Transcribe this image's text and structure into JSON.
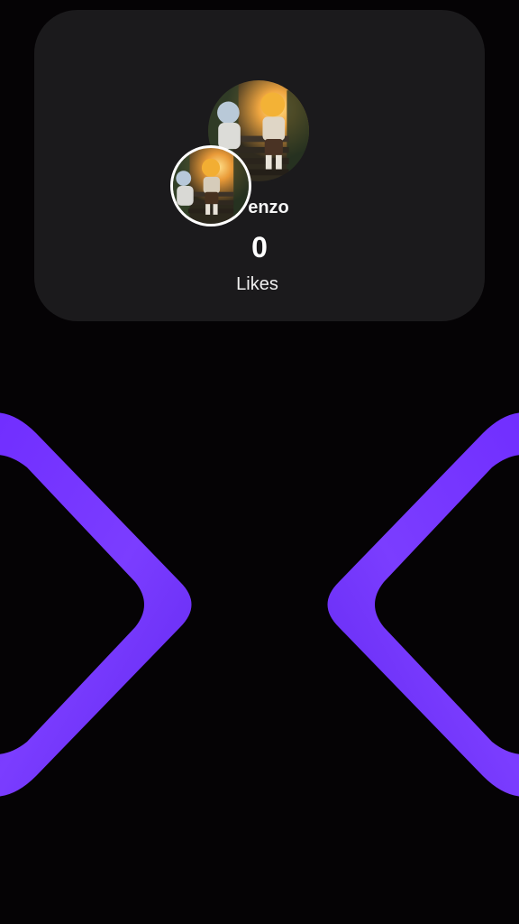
{
  "profile": {
    "username": "enzo",
    "likes_count": "0",
    "likes_label": "Likes"
  },
  "icons": {
    "avatar": "avatar-photo",
    "previous": "chevron-left-icon",
    "next": "chevron-right-icon"
  },
  "colors": {
    "background": "#050305",
    "card": "#1b1a1c",
    "accent": "#7a3cff",
    "text": "#ffffff"
  }
}
